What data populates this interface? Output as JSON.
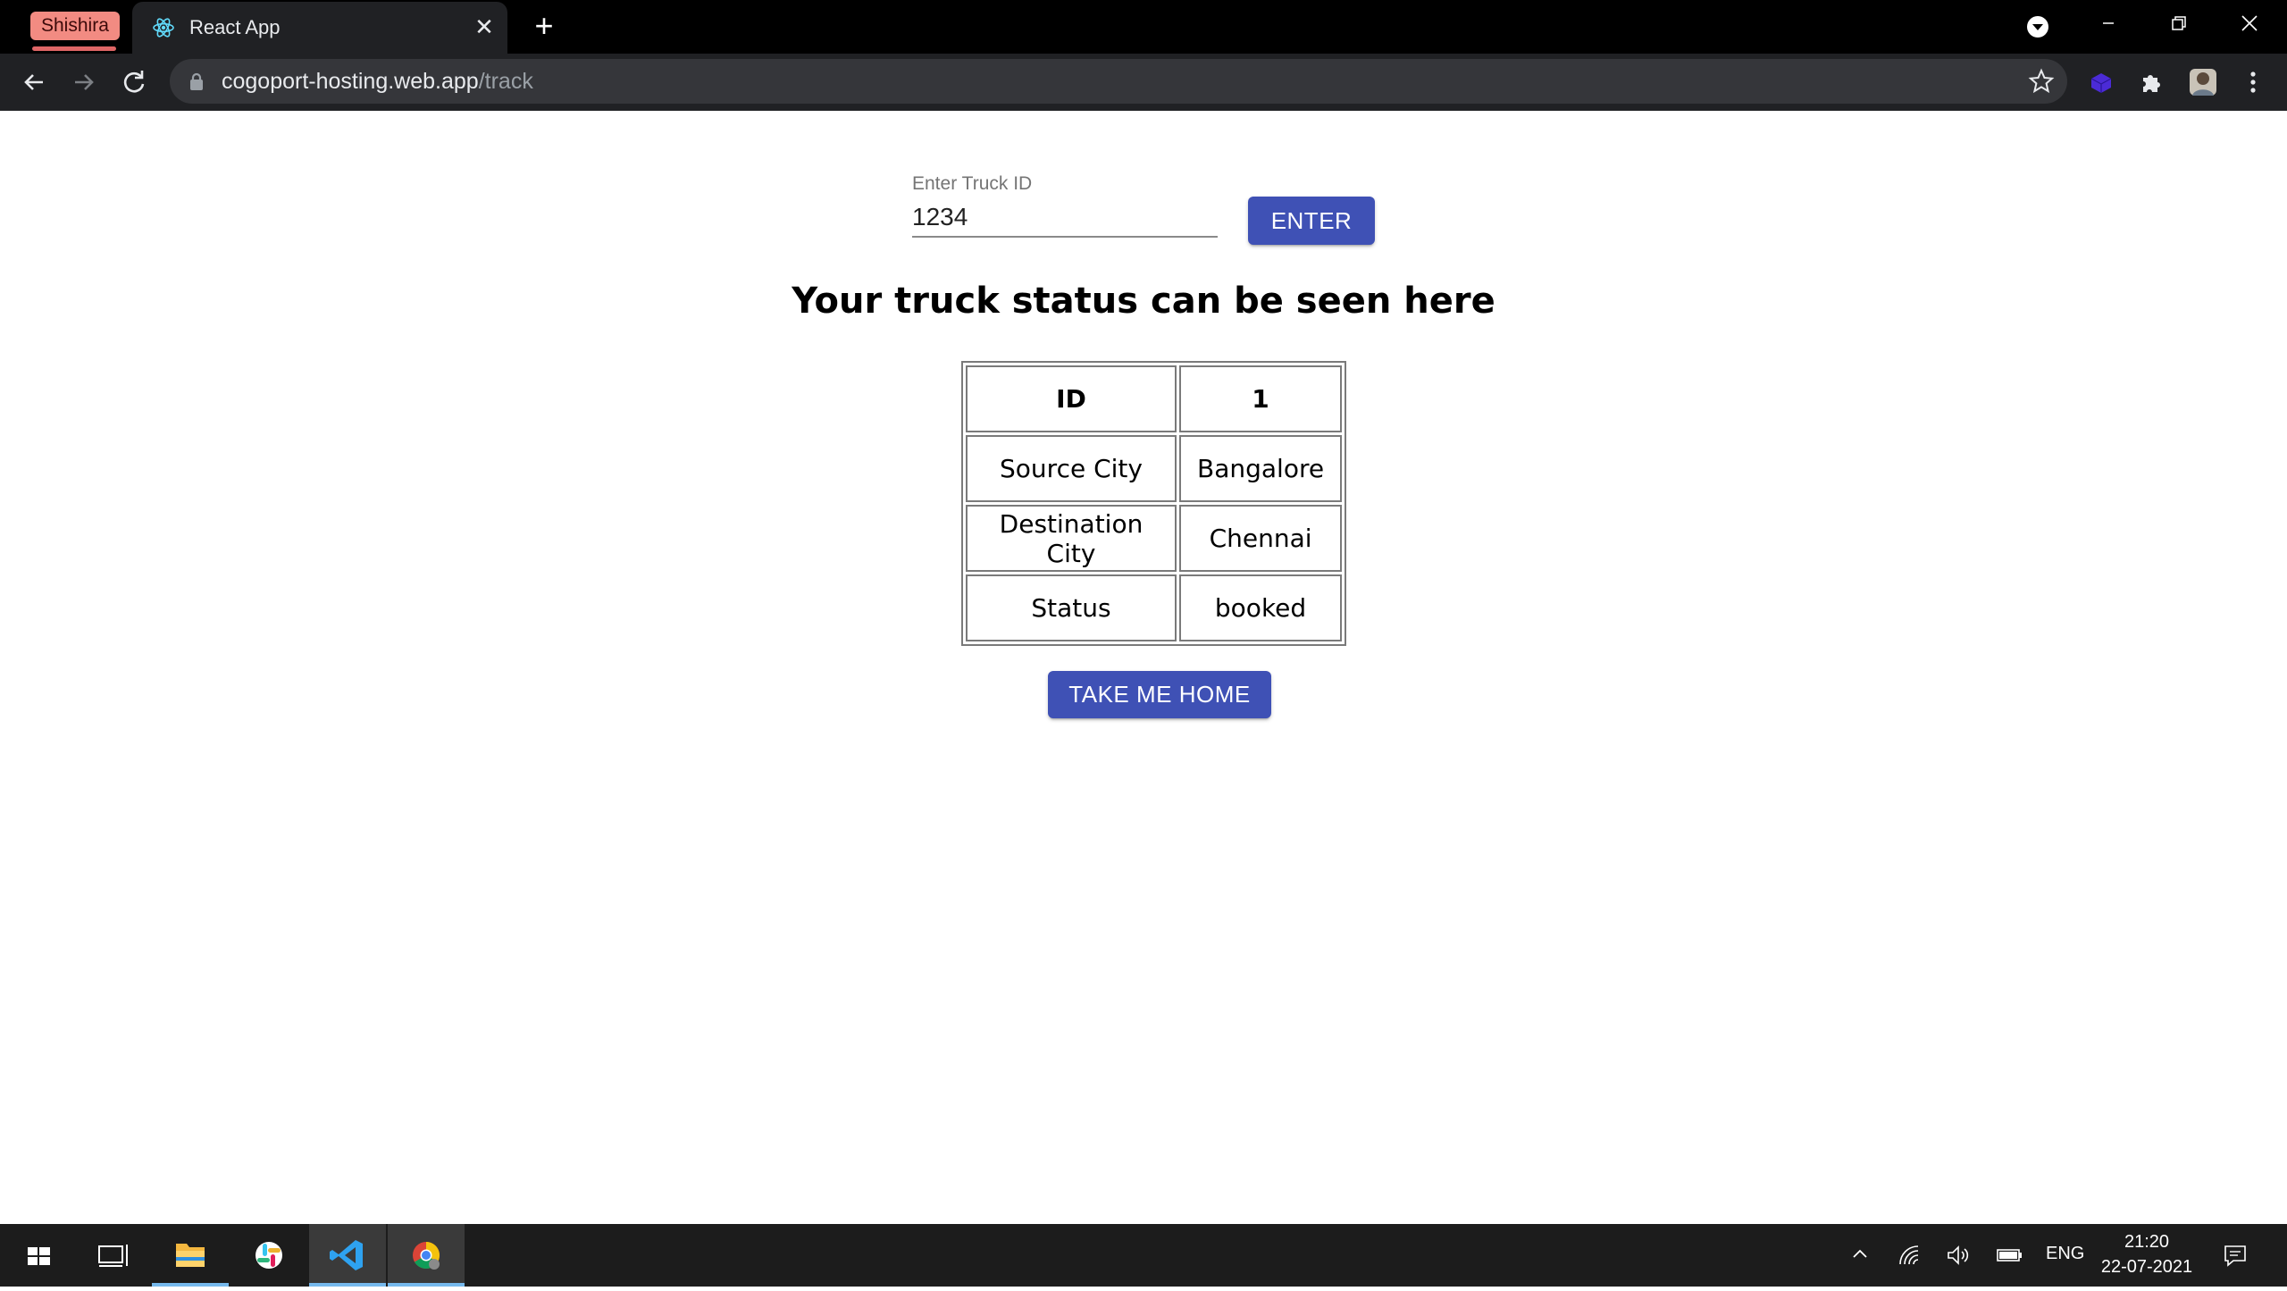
{
  "browser": {
    "profile_name": "Shishira",
    "tab_title": "React App",
    "tab_close": "✕",
    "new_tab": "+",
    "url_host": "cogoport-hosting.web.app",
    "url_path": "/track"
  },
  "page": {
    "input_label": "Enter Truck ID",
    "input_value": "1234",
    "enter_button": "ENTER",
    "heading": "Your truck status can be seen here",
    "table": [
      {
        "field": "ID",
        "value": "1"
      },
      {
        "field": "Source City",
        "value": "Bangalore"
      },
      {
        "field": "Destination City",
        "value": "Chennai"
      },
      {
        "field": "Status",
        "value": "booked"
      }
    ],
    "home_button": "TAKE ME HOME"
  },
  "taskbar": {
    "language": "ENG",
    "time": "21:20",
    "date": "22-07-2021"
  },
  "colors": {
    "primary_button": "#3f51b5",
    "profile_chip": "#f28b82",
    "taskbar_accent": "#76b9ed"
  }
}
